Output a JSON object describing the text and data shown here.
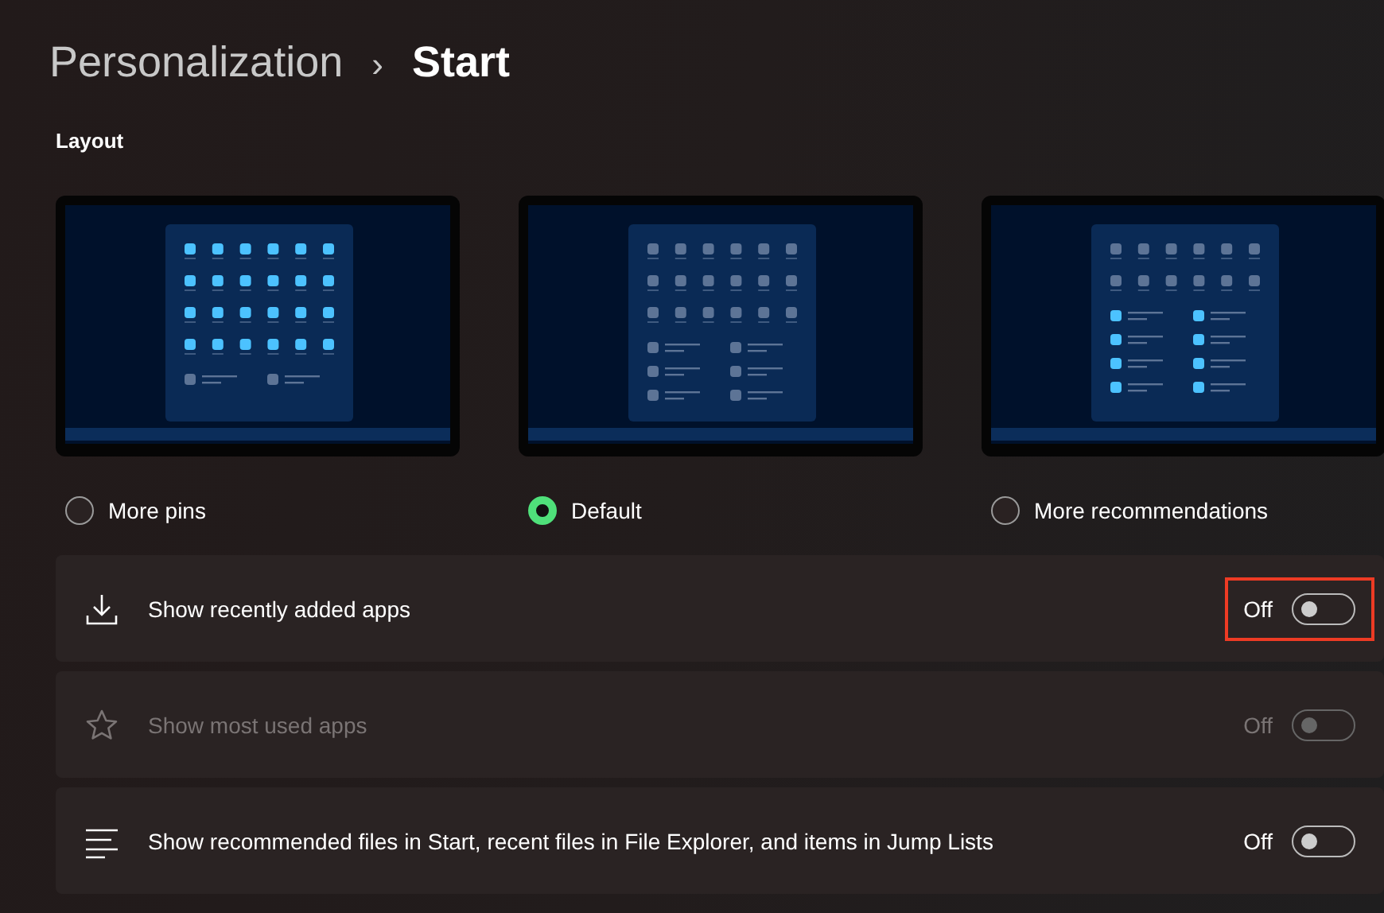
{
  "breadcrumb": {
    "parent": "Personalization",
    "separator": "›",
    "current": "Start"
  },
  "layout": {
    "heading": "Layout",
    "options": [
      {
        "label": "More pins",
        "kind": "pins",
        "selected": false
      },
      {
        "label": "Default",
        "kind": "default",
        "selected": true
      },
      {
        "label": "More recommendations",
        "kind": "recommendations",
        "selected": false
      }
    ]
  },
  "settings": [
    {
      "kind": "download",
      "label": "Show recently added apps",
      "state_text": "Off",
      "on": false,
      "disabled": false,
      "highlighted": true
    },
    {
      "kind": "star",
      "label": "Show most used apps",
      "state_text": "Off",
      "on": false,
      "disabled": true,
      "highlighted": false
    },
    {
      "kind": "lines",
      "label": "Show recommended files in Start, recent files in File Explorer, and items in Jump Lists",
      "state_text": "Off",
      "on": false,
      "disabled": false,
      "highlighted": false
    }
  ]
}
